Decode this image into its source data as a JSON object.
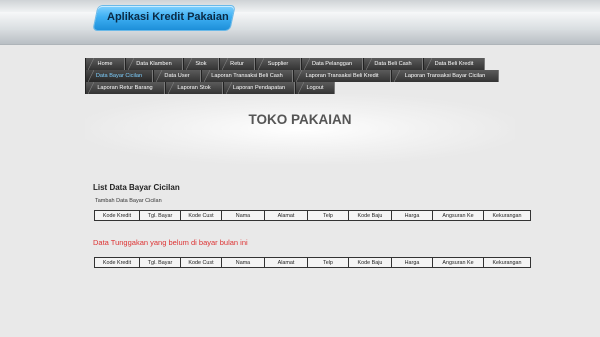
{
  "header": {
    "app_title": "Aplikasi Kredit Pakaian"
  },
  "nav": {
    "rows": [
      [
        {
          "label": "Home",
          "w": 40
        },
        {
          "label": "Data Klamben",
          "w": 58
        },
        {
          "label": "Stok",
          "w": 36
        },
        {
          "label": "Retur",
          "w": 36
        },
        {
          "label": "Supplier",
          "w": 46
        },
        {
          "label": "Data Pelanggan",
          "w": 62
        },
        {
          "label": "Data Beli Cash",
          "w": 60
        },
        {
          "label": "Data Beli Kredit",
          "w": 62
        }
      ],
      [
        {
          "label": "Data Bayar Cicilan",
          "w": 68,
          "active": true
        },
        {
          "label": "Data User",
          "w": 48
        },
        {
          "label": "Laporan Transaksi Beli Cash",
          "w": 92
        },
        {
          "label": "Laporan Transaksi Beli Kredit",
          "w": 98
        },
        {
          "label": "Laporan Transaksi Bayar Cicilan",
          "w": 108
        }
      ],
      [
        {
          "label": "Laporan Retur Barang",
          "w": 80
        },
        {
          "label": "Laporan Stok",
          "w": 58
        },
        {
          "label": "Laporan Pendapatan",
          "w": 72
        },
        {
          "label": "Logout",
          "w": 40
        }
      ]
    ]
  },
  "hero": {
    "title": "TOKO PAKAIAN"
  },
  "main": {
    "section_title": "List Data Bayar Cicilan",
    "add_link": "Tambah Data Bayar Cicilan",
    "columns": [
      "Kode Kredit",
      "Tgl. Bayar",
      "Kode Cust",
      "Nama",
      "Alamat",
      "Telp",
      "Kode Baju",
      "Harga",
      "Angsuran Ke",
      "Kekurangan"
    ],
    "warning": "Data Tunggakan yang belum di bayar bulan ini",
    "columns2": [
      "Kode Kredit",
      "Tgl. Bayar",
      "Kode Cust",
      "Nama",
      "Alamat",
      "Telp",
      "Kode Baju",
      "Harga",
      "Angsuran Ke",
      "Kekurangan"
    ]
  }
}
